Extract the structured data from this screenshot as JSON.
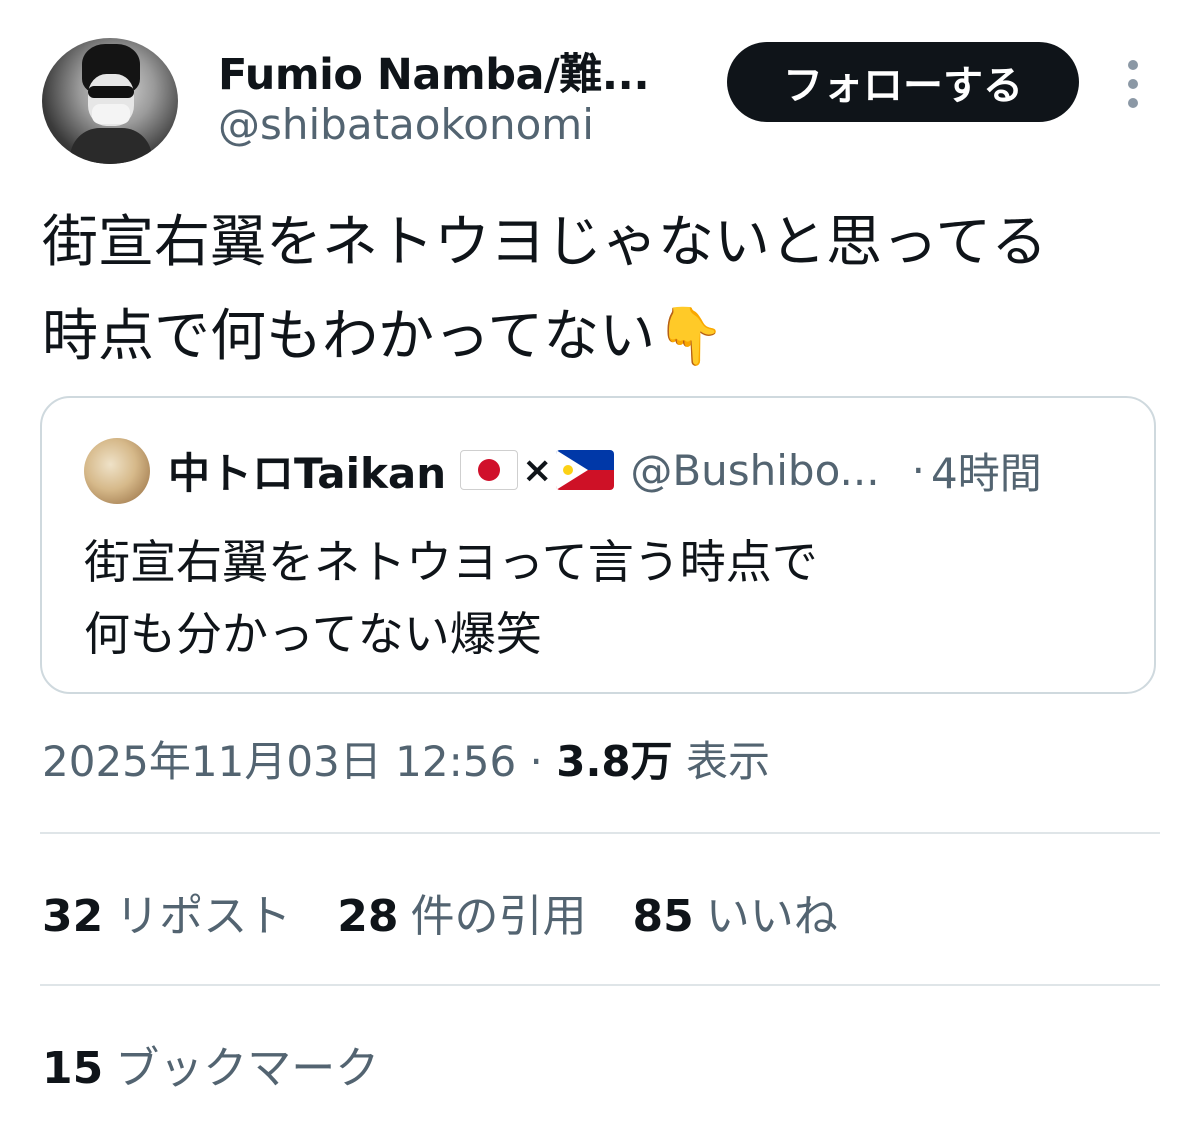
{
  "author": {
    "display_name": "Fumio Namba/難...",
    "handle": "@shibataokonomi",
    "avatar_icon": "profile-photo"
  },
  "actions": {
    "follow_label": "フォローする",
    "more_icon": "more-vertical-icon"
  },
  "tweet": {
    "text_lines": [
      "街宣右翼をネトウヨじゃないと思ってる",
      "時点で何もわかってない👇"
    ]
  },
  "quote": {
    "name": "中トロTaikan",
    "flag_1": "japan-flag",
    "separator": "×",
    "flag_2": "philippines-flag",
    "handle": "@Bushibo...",
    "dot": "·",
    "time": "4時間",
    "text_lines": [
      "街宣右翼をネトウヨって言う時点で",
      "何も分かってない爆笑"
    ]
  },
  "meta": {
    "timestamp": "2025年11月03日 12:56",
    "dot": "·",
    "views_count": "3.8万",
    "views_label": "表示"
  },
  "stats": [
    {
      "count": "32",
      "label": "リポスト"
    },
    {
      "count": "28",
      "label": "件の引用"
    },
    {
      "count": "85",
      "label": "いいね"
    }
  ],
  "bookmarks": {
    "count": "15",
    "label": "ブックマーク"
  },
  "colors": {
    "text": "#0f1419",
    "secondary": "#536471",
    "border": "#cfd9de",
    "button_bg": "#0f1419"
  }
}
